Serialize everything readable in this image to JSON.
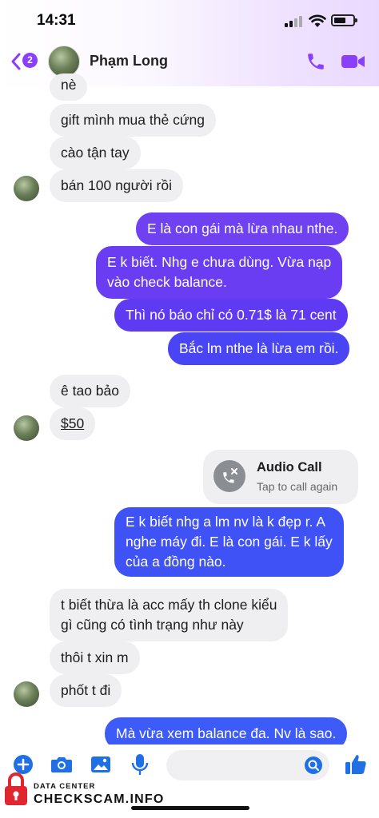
{
  "status_bar": {
    "time": "14:31"
  },
  "header": {
    "back_badge": "2",
    "contact_name": "Phạm Long"
  },
  "messages": {
    "m0": "nè",
    "m1": "gift mình mua thẻ cứng",
    "m2": "cào tận tay",
    "m3": "bán 100 người rồi",
    "m4": "E là con gái mà lừa nhau nthe.",
    "m5a": "E k biết. Nhg e chưa dùng. Vừa nạp",
    "m5b": "vào check balance.",
    "m6": "Thì nó báo chỉ có 0.71$ là 71 cent",
    "m7": "Bắc lm nthe là lừa em rồi.",
    "m8": "ê tao bảo",
    "m9": "$50",
    "m10a": "E k biết nhg a lm nv là k đẹp r. A",
    "m10b": "nghe máy đi. E là con gái. E k lấy",
    "m10c": "của a đồng nào.",
    "m11a": "t biết thừa là acc mấy th clone kiểu",
    "m11b": "gì cũng có tình trạng như này",
    "m12": "thôi t xin m",
    "m13": "phốt t đi",
    "m14": "Mà vừa xem balance đa. Nv là sao."
  },
  "audio_call": {
    "title": "Audio Call",
    "subtitle": "Tap to call again"
  },
  "composer": {
    "placeholder": ""
  },
  "watermark": {
    "top": "DATA CENTER",
    "main": "CHECKSCAM.INFO"
  },
  "colors": {
    "accent": "#8a3ffc",
    "outgoing": "#5e35f0",
    "incoming": "#efeff1",
    "composer_icon": "#1f6fe5"
  }
}
